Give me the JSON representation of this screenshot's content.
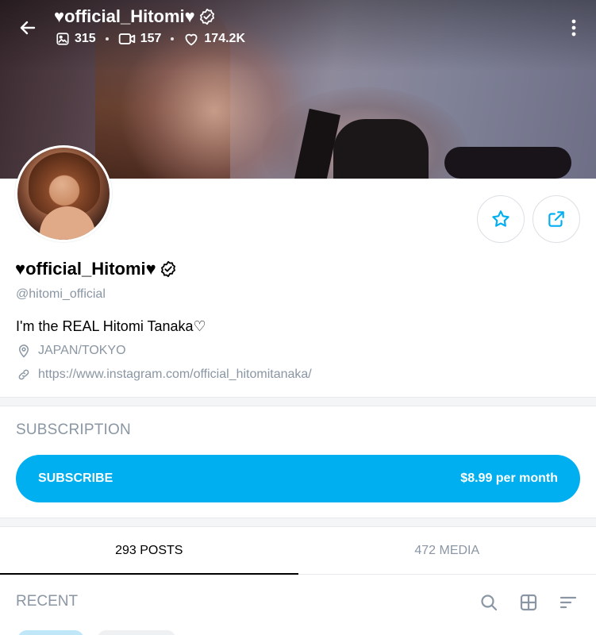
{
  "header": {
    "title": "♥official_Hitomi♥",
    "stats": {
      "photos": "315",
      "videos": "157",
      "likes": "174.2K"
    }
  },
  "profile": {
    "display_name": "♥official_Hitomi♥",
    "handle": "@hitomi_official",
    "bio": "I'm the REAL Hitomi Tanaka♡",
    "location": "JAPAN/TOKYO",
    "website": "https://www.instagram.com/official_hitomitanaka/"
  },
  "subscription": {
    "section_title": "SUBSCRIPTION",
    "button_label": "SUBSCRIBE",
    "price": "$8.99 per month"
  },
  "tabs": [
    {
      "label": "293 POSTS",
      "active": true
    },
    {
      "label": "472 MEDIA",
      "active": false
    }
  ],
  "recent": {
    "title": "RECENT"
  },
  "icons": {
    "back": "arrow-left-icon",
    "more": "more-vertical-icon",
    "photos": "image-icon",
    "videos": "video-icon",
    "likes": "heart-icon",
    "verified": "verified-badge-icon",
    "favorite": "star-icon",
    "share": "share-icon",
    "location": "location-pin-icon",
    "link": "link-icon",
    "search": "search-icon",
    "grid": "grid-icon",
    "sort": "sort-icon"
  },
  "colors": {
    "accent": "#00aff0",
    "muted_text": "#8a96a3",
    "divider": "#f4f5f7"
  }
}
